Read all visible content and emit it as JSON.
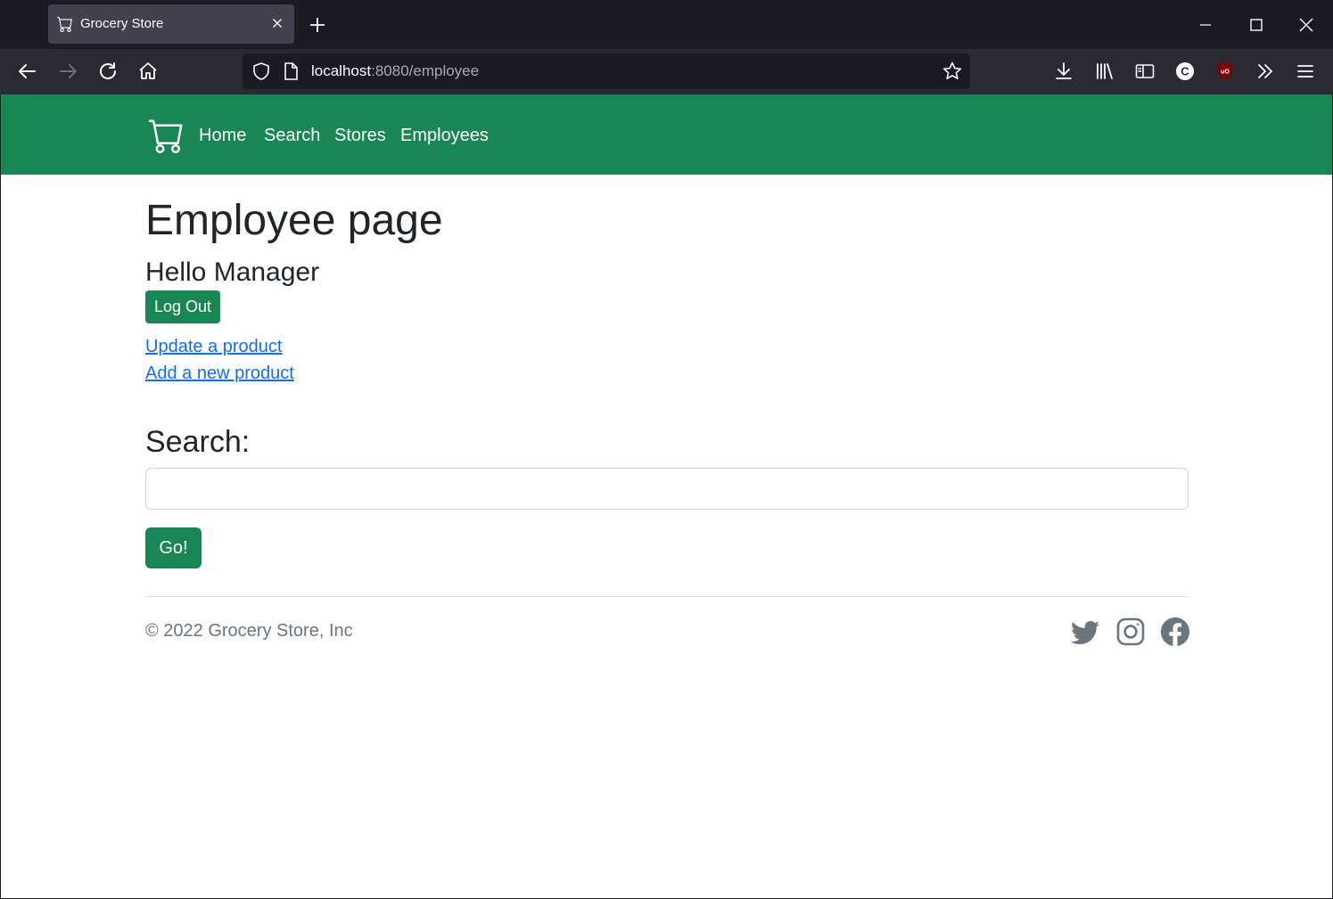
{
  "browser": {
    "tab": {
      "title": "Grocery Store",
      "icon": "cart-icon"
    },
    "url": {
      "host": "localhost",
      "rest": ":8080/employee"
    }
  },
  "site": {
    "nav": {
      "brand_icon": "cart-icon",
      "links": [
        "Home",
        "Search",
        "Stores",
        "Employees"
      ]
    },
    "main": {
      "title": "Employee page",
      "greeting": "Hello Manager",
      "logout_label": "Log Out",
      "links": [
        "Update a product",
        "Add a new product"
      ],
      "search_label": "Search:",
      "search_value": "",
      "go_label": "Go!"
    },
    "footer": {
      "copyright": "© 2022 Grocery Store, Inc",
      "social": [
        "twitter-icon",
        "instagram-icon",
        "facebook-icon"
      ]
    }
  },
  "colors": {
    "brand_green": "#198754",
    "link_blue": "#0d6efd"
  }
}
